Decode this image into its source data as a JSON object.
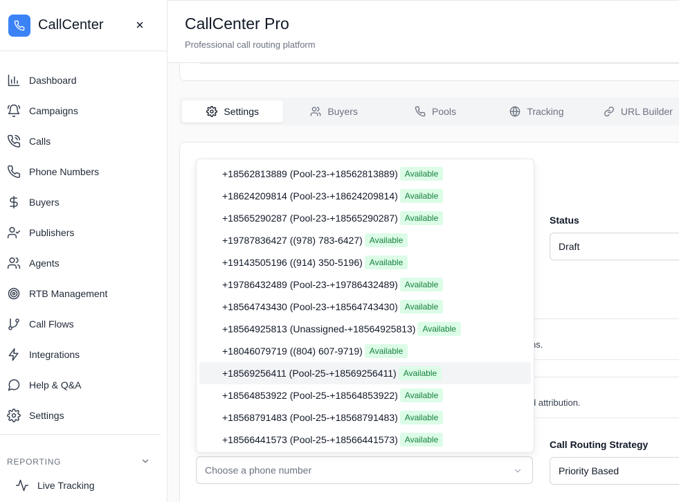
{
  "brand": {
    "name": "CallCenter"
  },
  "sidebar": {
    "items": [
      {
        "label": "Dashboard",
        "icon": "bar-chart-icon"
      },
      {
        "label": "Campaigns",
        "icon": "bell-icon"
      },
      {
        "label": "Calls",
        "icon": "phone-call-icon"
      },
      {
        "label": "Phone Numbers",
        "icon": "phone-icon"
      },
      {
        "label": "Buyers",
        "icon": "dollar-icon"
      },
      {
        "label": "Publishers",
        "icon": "user-check-icon"
      },
      {
        "label": "Agents",
        "icon": "users-icon"
      },
      {
        "label": "RTB Management",
        "icon": "target-icon"
      },
      {
        "label": "Call Flows",
        "icon": "git-branch-icon"
      },
      {
        "label": "Integrations",
        "icon": "zap-icon"
      },
      {
        "label": "Help & Q&A",
        "icon": "message-circle-icon"
      },
      {
        "label": "Settings",
        "icon": "settings-icon"
      }
    ],
    "reporting_label": "REPORTING",
    "live_tracking": "Live Tracking"
  },
  "header": {
    "title": "CallCenter Pro",
    "subtitle": "Professional call routing platform"
  },
  "tabs": [
    {
      "label": "Settings",
      "active": true
    },
    {
      "label": "Buyers"
    },
    {
      "label": "Pools"
    },
    {
      "label": "Tracking"
    },
    {
      "label": "URL Builder"
    }
  ],
  "form": {
    "status_label": "Status",
    "status_value": "Draft",
    "routing_label": "Call Routing Strategy",
    "routing_value": "Priority Based",
    "fragment_1": ".",
    "fragment_2": "ns.",
    "fragment_3": "d attribution.",
    "phone_placeholder": "Choose a phone number"
  },
  "dropdown": {
    "badge_color": "#15803d",
    "options": [
      {
        "text": "+18562813889 (Pool-23-+18562813889)",
        "badge": "Available"
      },
      {
        "text": "+18624209814 (Pool-23-+18624209814)",
        "badge": "Available"
      },
      {
        "text": "+18565290287 (Pool-23-+18565290287)",
        "badge": "Available"
      },
      {
        "text": "+19787836427 ((978) 783-6427)",
        "badge": "Available"
      },
      {
        "text": "+19143505196 ((914) 350-5196)",
        "badge": "Available"
      },
      {
        "text": "+19786432489 (Pool-23-+19786432489)",
        "badge": "Available"
      },
      {
        "text": "+18564743430 (Pool-23-+18564743430)",
        "badge": "Available"
      },
      {
        "text": "+18564925813 (Unassigned-+18564925813)",
        "badge": "Available"
      },
      {
        "text": "+18046079719 ((804) 607-9719)",
        "badge": "Available"
      },
      {
        "text": "+18569256411 (Pool-25-+18569256411)",
        "badge": "Available"
      },
      {
        "text": "+18564853922 (Pool-25-+18564853922)",
        "badge": "Available"
      },
      {
        "text": "+18568791483 (Pool-25-+18568791483)",
        "badge": "Available"
      },
      {
        "text": "+18566441573 (Pool-25-+18566441573)",
        "badge": "Available"
      }
    ]
  }
}
